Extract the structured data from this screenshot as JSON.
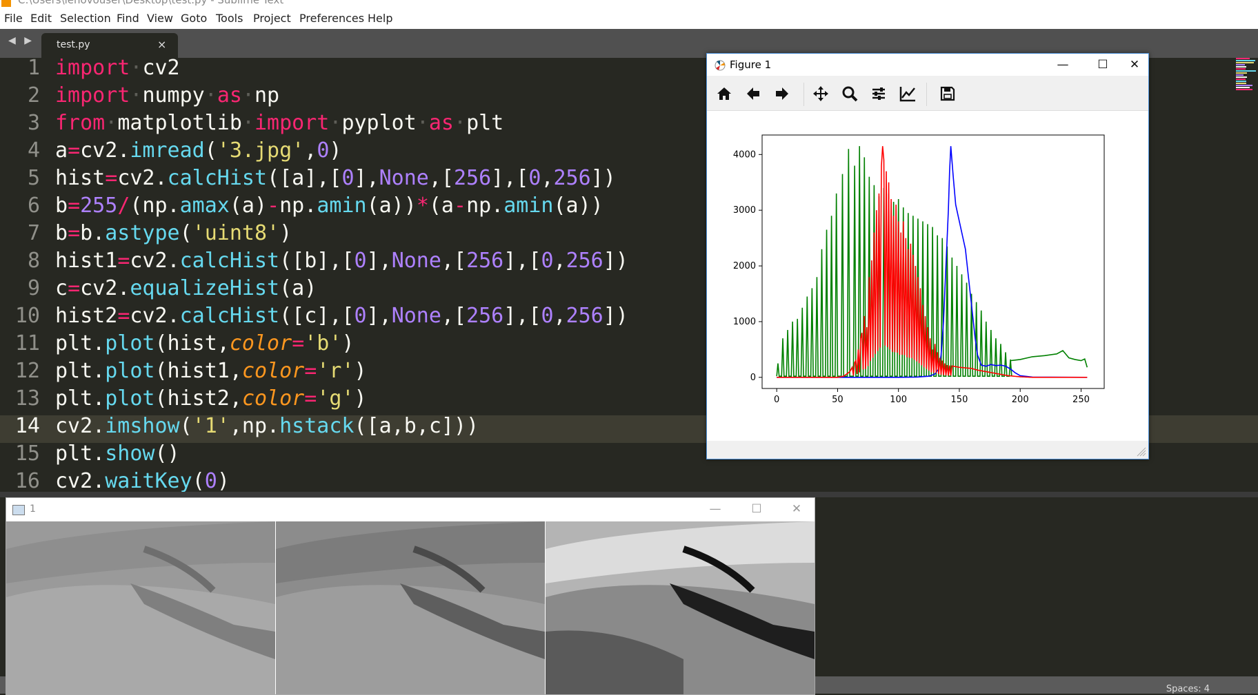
{
  "window": {
    "title": "C:\\Users\\lenovouser\\Desktop\\test.py - Sublime Text"
  },
  "menu": [
    "File",
    "Edit",
    "Selection",
    "Find",
    "View",
    "Goto",
    "Tools",
    "Project",
    "Preferences",
    "Help"
  ],
  "tab": {
    "nav": "◀ ▶",
    "label": "test.py",
    "close": "×"
  },
  "editor": {
    "active_line": 14,
    "line_numbers": [
      "1",
      "2",
      "3",
      "4",
      "5",
      "6",
      "7",
      "8",
      "9",
      "10",
      "11",
      "12",
      "13",
      "14",
      "15",
      "16"
    ],
    "lines": [
      "import cv2",
      "import numpy as np",
      "from matplotlib import pyplot as plt",
      "a=cv2.imread('3.jpg',0)",
      "hist=cv2.calcHist([a],[0],None,[256],[0,256])",
      "b=255/(np.amax(a)-np.amin(a))*(a-np.amin(a))",
      "b=b.astype('uint8')",
      "hist1=cv2.calcHist([b],[0],None,[256],[0,256])",
      "c=cv2.equalizeHist(a)",
      "hist2=cv2.calcHist([c],[0],None,[256],[0,256])",
      "plt.plot(hist,color='b')",
      "plt.plot(hist1,color='r')",
      "plt.plot(hist2,color='g')",
      "cv2.imshow('1',np.hstack([a,b,c]))",
      "plt.show()",
      "cv2.waitKey(0)"
    ]
  },
  "status": {
    "spaces": "Spaces: 4"
  },
  "figure": {
    "title": "Figure 1",
    "window_controls": {
      "minimize": "—",
      "maximize": "☐",
      "close": "✕"
    },
    "toolbar": [
      "home-icon",
      "back-icon",
      "forward-icon",
      "pan-icon",
      "zoom-icon",
      "configure-subplots-icon",
      "edit-axis-icon",
      "save-icon"
    ]
  },
  "chart_data": {
    "type": "line",
    "title": "",
    "xlabel": "",
    "ylabel": "",
    "xlim": [
      -12,
      269
    ],
    "ylim": [
      -200,
      4350
    ],
    "xticks": [
      0,
      50,
      100,
      150,
      200,
      250
    ],
    "yticks": [
      0,
      1000,
      2000,
      3000,
      4000
    ],
    "grid": false,
    "legend": "none",
    "series": [
      {
        "color": "#0000ff",
        "points": [
          [
            0,
            0
          ],
          [
            70,
            0
          ],
          [
            100,
            0
          ],
          [
            115,
            5
          ],
          [
            125,
            20
          ],
          [
            130,
            60
          ],
          [
            133,
            150
          ],
          [
            135,
            400
          ],
          [
            137,
            1000
          ],
          [
            139,
            2000
          ],
          [
            141,
            3000
          ],
          [
            142,
            3700
          ],
          [
            143,
            4150
          ],
          [
            145,
            3600
          ],
          [
            147,
            3100
          ],
          [
            149,
            2900
          ],
          [
            151,
            2700
          ],
          [
            153,
            2500
          ],
          [
            155,
            2300
          ],
          [
            157,
            1900
          ],
          [
            159,
            1500
          ],
          [
            161,
            1100
          ],
          [
            163,
            700
          ],
          [
            165,
            400
          ],
          [
            168,
            220
          ],
          [
            172,
            200
          ],
          [
            176,
            230
          ],
          [
            180,
            210
          ],
          [
            184,
            220
          ],
          [
            188,
            200
          ],
          [
            192,
            150
          ],
          [
            196,
            80
          ],
          [
            200,
            30
          ],
          [
            210,
            5
          ],
          [
            255,
            0
          ]
        ]
      },
      {
        "color": "#ff0000",
        "points": [
          [
            0,
            0
          ],
          [
            40,
            0
          ],
          [
            50,
            0
          ],
          [
            55,
            20
          ],
          [
            60,
            100
          ],
          [
            65,
            300
          ],
          [
            70,
            800
          ],
          [
            72,
            1100
          ],
          [
            74,
            900
          ],
          [
            76,
            1800
          ],
          [
            78,
            2100
          ],
          [
            80,
            2600
          ],
          [
            82,
            3000
          ],
          [
            84,
            3300
          ],
          [
            86,
            3800
          ],
          [
            87,
            4150
          ],
          [
            88,
            3900
          ],
          [
            90,
            3700
          ],
          [
            92,
            3500
          ],
          [
            94,
            3200
          ],
          [
            96,
            2900
          ],
          [
            98,
            3100
          ],
          [
            100,
            2800
          ],
          [
            102,
            2600
          ],
          [
            104,
            2800
          ],
          [
            106,
            2500
          ],
          [
            108,
            2300
          ],
          [
            110,
            2400
          ],
          [
            112,
            2200
          ],
          [
            114,
            2000
          ],
          [
            116,
            1800
          ],
          [
            118,
            1600
          ],
          [
            120,
            1300
          ],
          [
            122,
            1100
          ],
          [
            124,
            900
          ],
          [
            126,
            700
          ],
          [
            128,
            500
          ],
          [
            130,
            600
          ],
          [
            132,
            450
          ],
          [
            134,
            350
          ],
          [
            136,
            300
          ],
          [
            138,
            250
          ],
          [
            140,
            220
          ],
          [
            145,
            200
          ],
          [
            150,
            180
          ],
          [
            155,
            170
          ],
          [
            160,
            160
          ],
          [
            165,
            130
          ],
          [
            170,
            110
          ],
          [
            175,
            90
          ],
          [
            180,
            70
          ],
          [
            185,
            50
          ],
          [
            190,
            30
          ],
          [
            200,
            10
          ],
          [
            210,
            0
          ],
          [
            255,
            0
          ]
        ]
      },
      {
        "color": "#008000",
        "spikes": [
          [
            0,
            250
          ],
          [
            4,
            700
          ],
          [
            8,
            850
          ],
          [
            12,
            1000
          ],
          [
            16,
            1050
          ],
          [
            20,
            1250
          ],
          [
            24,
            1450
          ],
          [
            28,
            1600
          ],
          [
            32,
            1800
          ],
          [
            36,
            2300
          ],
          [
            40,
            2650
          ],
          [
            44,
            2900
          ],
          [
            48,
            3300
          ],
          [
            53,
            3650
          ],
          [
            58,
            4100
          ],
          [
            63,
            3800
          ],
          [
            67,
            4150
          ],
          [
            71,
            3950
          ],
          [
            75,
            3600
          ],
          [
            79,
            3450
          ],
          [
            83,
            3250
          ],
          [
            87,
            3400
          ],
          [
            91,
            3300
          ],
          [
            95,
            3150
          ],
          [
            99,
            3200
          ],
          [
            103,
            3050
          ],
          [
            107,
            2950
          ],
          [
            111,
            2900
          ],
          [
            115,
            2850
          ],
          [
            119,
            2800
          ],
          [
            123,
            2750
          ],
          [
            127,
            2700
          ],
          [
            131,
            2550
          ],
          [
            135,
            2500
          ],
          [
            139,
            2350
          ],
          [
            143,
            2150
          ],
          [
            147,
            2000
          ],
          [
            151,
            1850
          ],
          [
            155,
            1700
          ],
          [
            159,
            1500
          ],
          [
            163,
            1350
          ],
          [
            167,
            1200
          ],
          [
            171,
            1000
          ],
          [
            175,
            850
          ],
          [
            179,
            700
          ],
          [
            183,
            600
          ],
          [
            187,
            450
          ],
          [
            191,
            320
          ]
        ],
        "baseline_tail": [
          [
            192,
            300
          ],
          [
            200,
            320
          ],
          [
            210,
            370
          ],
          [
            220,
            390
          ],
          [
            230,
            420
          ],
          [
            235,
            480
          ],
          [
            240,
            350
          ],
          [
            245,
            320
          ],
          [
            250,
            300
          ],
          [
            253,
            330
          ],
          [
            255,
            180
          ]
        ]
      }
    ]
  },
  "cv_window": {
    "title": "1",
    "window_controls": {
      "minimize": "—",
      "maximize": "☐",
      "close": "✕"
    }
  }
}
